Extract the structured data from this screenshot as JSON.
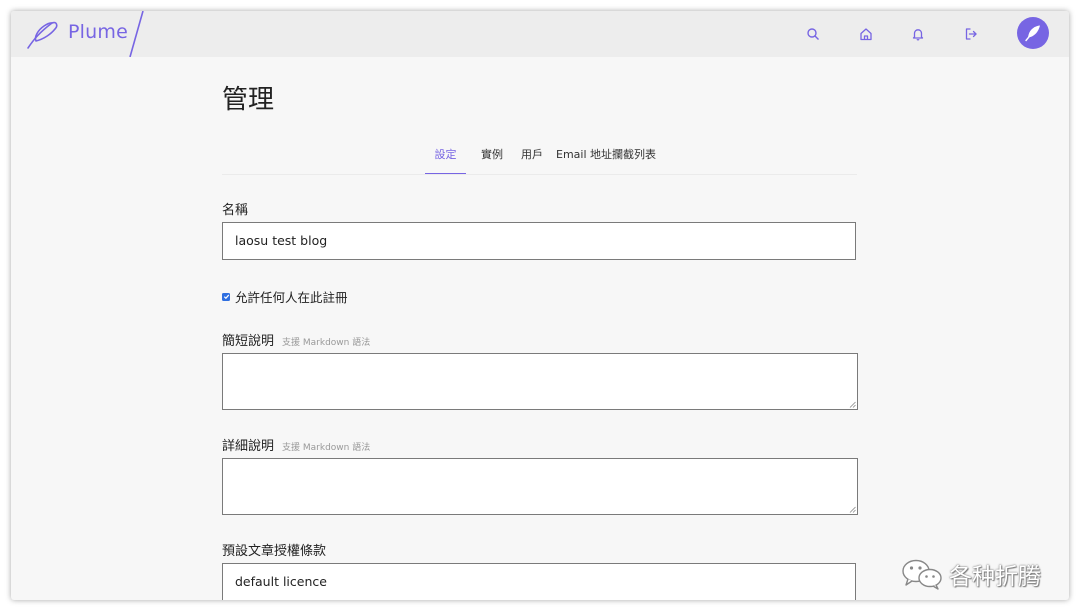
{
  "app": {
    "brand": "Plume",
    "accent_color": "#7765e3"
  },
  "header": {
    "icons": [
      "search-icon",
      "home-icon",
      "bell-icon",
      "logout-icon",
      "feather-avatar"
    ]
  },
  "page": {
    "title": "管理"
  },
  "tabs": [
    {
      "label": "設定",
      "active": true
    },
    {
      "label": "實例",
      "active": false
    },
    {
      "label": "用戶",
      "active": false
    },
    {
      "label": "Email 地址攔截列表",
      "active": false
    }
  ],
  "form": {
    "name": {
      "label": "名稱",
      "value": "laosu test blog"
    },
    "open_registration": {
      "label": "允許任何人在此註冊",
      "checked": true
    },
    "short_description": {
      "label": "簡短說明",
      "hint": "支援 Markdown 語法",
      "value": ""
    },
    "long_description": {
      "label": "詳細說明",
      "hint": "支援 Markdown 語法",
      "value": ""
    },
    "default_license": {
      "label": "預設文章授權條款",
      "value": "default licence"
    }
  },
  "watermark": {
    "text": "各种折腾",
    "icon": "wechat-icon"
  }
}
